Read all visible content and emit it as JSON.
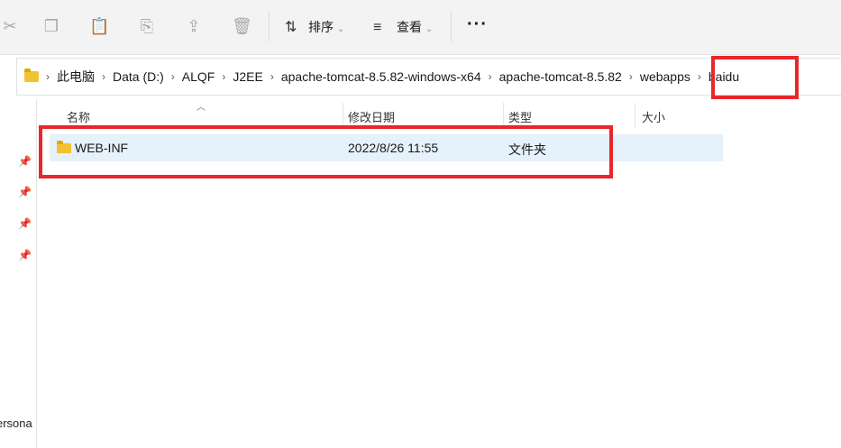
{
  "toolbar": {
    "icons": [
      "scissors-icon",
      "copy-icon",
      "paste-icon",
      "rename-icon",
      "share-icon",
      "delete-icon"
    ],
    "sort_label": "排序",
    "view_label": "查看",
    "more_label": "···"
  },
  "breadcrumb": [
    "此电脑",
    "Data (D:)",
    "ALQF",
    "J2EE",
    "apache-tomcat-8.5.82-windows-x64",
    "apache-tomcat-8.5.82",
    "webapps",
    "baidu"
  ],
  "columns": {
    "name": "名称",
    "modified": "修改日期",
    "type": "类型",
    "size": "大小"
  },
  "files": [
    {
      "name": "WEB-INF",
      "modified": "2022/8/26 11:55",
      "type": "文件夹",
      "size": ""
    }
  ],
  "leftpane": {
    "partial_label": "ersona"
  },
  "colors": {
    "highlight": "#e8262b",
    "selected_row": "#e5f1fb",
    "folder": "#f1c232"
  }
}
